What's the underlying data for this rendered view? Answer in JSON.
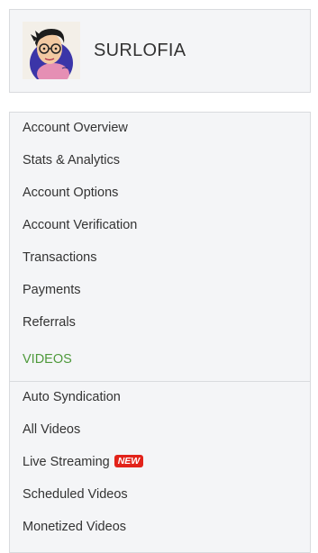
{
  "profile": {
    "username": "SURLOFIA"
  },
  "menu": {
    "items": [
      {
        "label": "Account Overview"
      },
      {
        "label": "Stats & Analytics"
      },
      {
        "label": "Account Options"
      },
      {
        "label": "Account Verification"
      },
      {
        "label": "Transactions"
      },
      {
        "label": "Payments"
      },
      {
        "label": "Referrals"
      }
    ],
    "videos_section": {
      "label": "VIDEOS",
      "items": [
        {
          "label": "Auto Syndication"
        },
        {
          "label": "All Videos"
        },
        {
          "label": "Live Streaming",
          "badge": "NEW"
        },
        {
          "label": "Scheduled Videos"
        },
        {
          "label": "Monetized Videos"
        }
      ]
    }
  },
  "colors": {
    "section_accent": "#4f9a3c",
    "badge_red": "#e2231a",
    "card_background": "#f4f5f7",
    "border": "#d9dbde"
  }
}
